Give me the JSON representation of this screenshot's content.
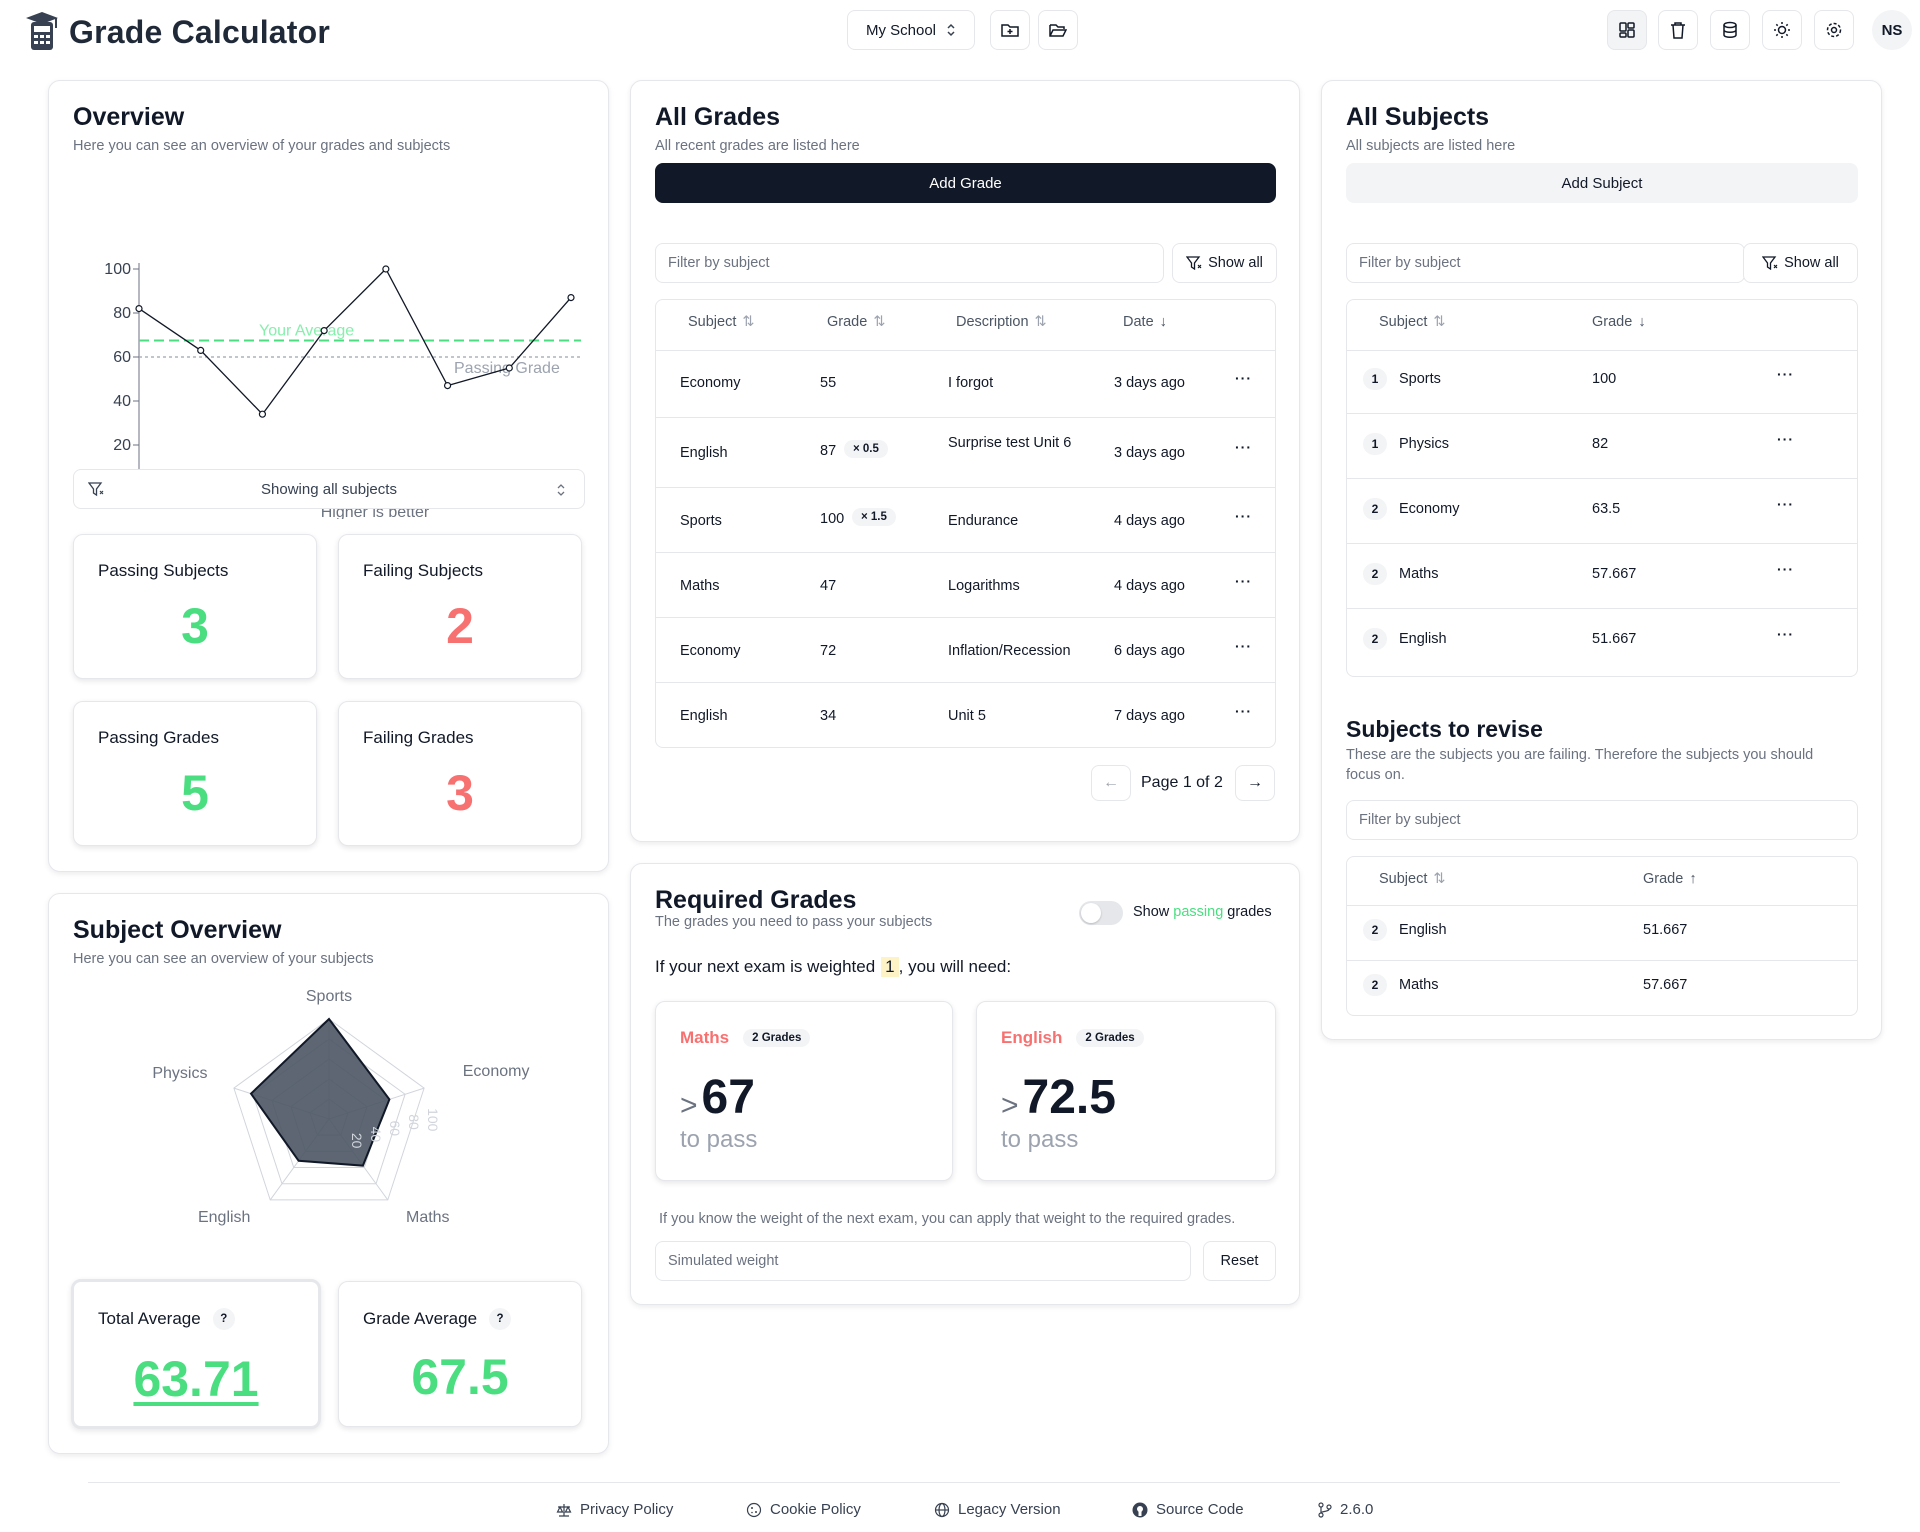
{
  "app": {
    "title": "Grade Calculator",
    "school": "My School",
    "user_initials": "NS"
  },
  "overview": {
    "title": "Overview",
    "subtitle": "Here you can see an overview of your grades and subjects",
    "chart_labels": {
      "average": "Your Average",
      "passing": "Passing Grade",
      "xlabel": "Higher is better"
    },
    "subject_filter": "Showing all subjects",
    "passing_subjects_label": "Passing Subjects",
    "passing_subjects": "3",
    "failing_subjects_label": "Failing Subjects",
    "failing_subjects": "2",
    "passing_grades_label": "Passing Grades",
    "passing_grades": "5",
    "failing_grades_label": "Failing Grades",
    "failing_grades": "3"
  },
  "chart_data": [
    {
      "type": "line",
      "xlabel": "Higher is better",
      "ylim": [
        0,
        100
      ],
      "yticks": [
        0,
        20,
        40,
        60,
        80,
        100
      ],
      "values": [
        82,
        63,
        34,
        72,
        100,
        47,
        55,
        87
      ],
      "reference_lines": [
        {
          "label": "Your Average",
          "value": 67.5,
          "color": "#4ade80"
        },
        {
          "label": "Passing Grade",
          "value": 60,
          "color": "#9ca3af"
        }
      ]
    },
    {
      "type": "radar",
      "categories": [
        "Sports",
        "Economy",
        "Maths",
        "English",
        "Physics"
      ],
      "values": [
        100,
        63.5,
        57.667,
        51.667,
        82
      ],
      "tick_labels": [
        "20",
        "40",
        "60",
        "80",
        "100"
      ]
    }
  ],
  "subject_overview": {
    "title": "Subject Overview",
    "subtitle": "Here you can see an overview of your subjects",
    "radar_labels": {
      "sports": "Sports",
      "economy": "Economy",
      "maths": "Maths",
      "english": "English",
      "physics": "Physics"
    },
    "total_average_label": "Total Average",
    "total_average": "63.71",
    "grade_average_label": "Grade Average",
    "grade_average": "67.5",
    "help": "?"
  },
  "all_grades": {
    "title": "All Grades",
    "subtitle": "All recent grades are listed here",
    "add_button": "Add Grade",
    "filter_placeholder": "Filter by subject",
    "show_all": "Show all",
    "headers": {
      "subject": "Subject",
      "grade": "Grade",
      "description": "Description",
      "date": "Date"
    },
    "rows": [
      {
        "subject": "Economy",
        "grade": "55",
        "weight": "",
        "description": "I forgot",
        "date": "3 days ago"
      },
      {
        "subject": "English",
        "grade": "87",
        "weight": "× 0.5",
        "description": "Surprise test Unit 6",
        "date": "3 days ago"
      },
      {
        "subject": "Sports",
        "grade": "100",
        "weight": "× 1.5",
        "description": "Endurance",
        "date": "4 days ago"
      },
      {
        "subject": "Maths",
        "grade": "47",
        "weight": "",
        "description": "Logarithms",
        "date": "4 days ago"
      },
      {
        "subject": "Economy",
        "grade": "72",
        "weight": "",
        "description": "Inflation/Recession",
        "date": "6 days ago"
      },
      {
        "subject": "English",
        "grade": "34",
        "weight": "",
        "description": "Unit 5",
        "date": "7 days ago"
      }
    ],
    "pagination": "Page 1 of 2"
  },
  "required_grades": {
    "title": "Required Grades",
    "subtitle": "The grades you need to pass your subjects",
    "toggle_show": "Show",
    "toggle_passing": "passing",
    "toggle_grades": "grades",
    "weight_prefix": "If your next exam is weighted",
    "weight_value": "1",
    "weight_suffix": ", you will need:",
    "cards": [
      {
        "subject": "Maths",
        "count": "2 Grades",
        "symbol": ">",
        "value": "67",
        "caption": "to pass"
      },
      {
        "subject": "English",
        "count": "2 Grades",
        "symbol": ">",
        "value": "72.5",
        "caption": "to pass"
      }
    ],
    "hint": "If you know the weight of the next exam, you can apply that weight to the required grades.",
    "simulated_placeholder": "Simulated weight",
    "reset": "Reset"
  },
  "all_subjects": {
    "title": "All Subjects",
    "subtitle": "All subjects are listed here",
    "add_button": "Add Subject",
    "filter_placeholder": "Filter by subject",
    "show_all": "Show all",
    "headers": {
      "subject": "Subject",
      "grade": "Grade"
    },
    "rows": [
      {
        "rank": "1",
        "subject": "Sports",
        "grade": "100",
        "status": "pass"
      },
      {
        "rank": "1",
        "subject": "Physics",
        "grade": "82",
        "status": "pass"
      },
      {
        "rank": "2",
        "subject": "Economy",
        "grade": "63.5",
        "status": "pass"
      },
      {
        "rank": "2",
        "subject": "Maths",
        "grade": "57.667",
        "status": "fail"
      },
      {
        "rank": "2",
        "subject": "English",
        "grade": "51.667",
        "status": "fail"
      }
    ]
  },
  "revise": {
    "title": "Subjects to revise",
    "subtitle": "These are the subjects you are failing. Therefore the subjects you should focus on.",
    "filter_placeholder": "Filter by subject",
    "headers": {
      "subject": "Subject",
      "grade": "Grade"
    },
    "rows": [
      {
        "rank": "2",
        "subject": "English",
        "grade": "51.667"
      },
      {
        "rank": "2",
        "subject": "Maths",
        "grade": "57.667"
      }
    ]
  },
  "footer": {
    "privacy": "Privacy Policy",
    "cookie": "Cookie Policy",
    "legacy": "Legacy Version",
    "source": "Source Code",
    "version": "2.6.0"
  }
}
